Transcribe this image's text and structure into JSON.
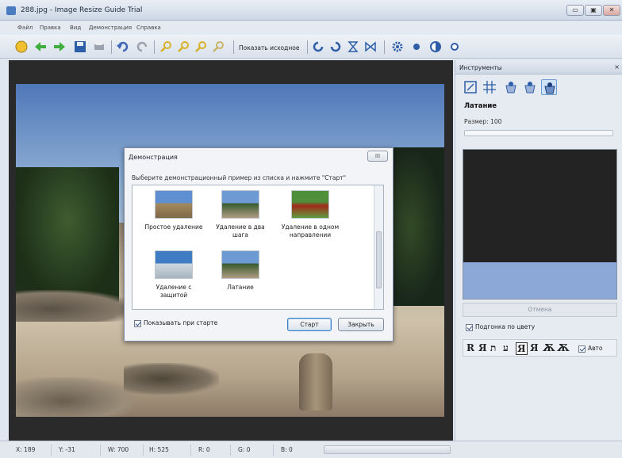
{
  "window": {
    "title": "288.jpg - Image Resize Guide Trial",
    "min": "▭",
    "max": "▣",
    "close": "✕"
  },
  "menu": [
    "Файл",
    "Правка",
    "Вид",
    "Демонстрация",
    "Справка"
  ],
  "toolbar": {
    "show_original": "Показать исходное"
  },
  "dialog": {
    "title": "Демонстрация",
    "close": "☒",
    "prompt": "Выберите демонстрационный пример из списка и нажмите \"Старт\"",
    "examples": [
      {
        "label": "Простое удаление"
      },
      {
        "label": "Удаление в два шага"
      },
      {
        "label": "Удаление в одном направлении"
      },
      {
        "label": "Удаление с защитой"
      },
      {
        "label": "Латание"
      }
    ],
    "show_at_start": "Показывать при старте",
    "start": "Старт",
    "close_button": "Закрыть"
  },
  "panel": {
    "title": "Инструменты",
    "close": "×",
    "heading": "Латание",
    "size": "Размер: 100",
    "cancel": "Отмена",
    "color_fit": "Подгонка по цвету",
    "modes": [
      "R",
      "Я",
      "ת",
      "ע",
      "Я",
      "Я",
      "Ѫ",
      "Ѫ"
    ],
    "auto": "Авто"
  },
  "status": {
    "x": "X: 189",
    "y": "Y: -31",
    "w": "W: 700",
    "h": "H: 525",
    "r": "R: 0",
    "g": "G: 0",
    "b": "B: 0"
  }
}
